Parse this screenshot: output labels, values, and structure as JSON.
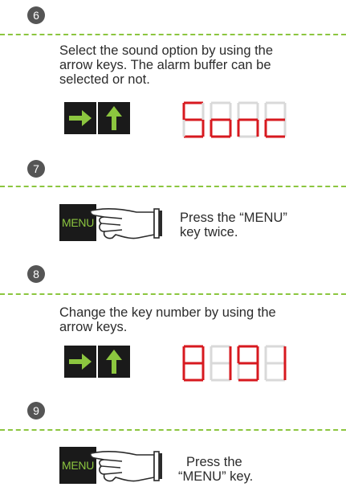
{
  "colors": {
    "accent_green": "#8cc63f",
    "segment_red": "#d7191f",
    "segment_dim": "#d9d9d9",
    "badge": "#555555",
    "key_bg": "#1a1a1a"
  },
  "steps": [
    {
      "number": "6",
      "text": [
        "Select the sound option by using the",
        "arrow keys. The alarm buffer can be",
        "selected or not."
      ],
      "icons": [
        "arrow-right-icon",
        "arrow-up-icon"
      ],
      "display": "Sonc"
    },
    {
      "number": "7",
      "key_label": "MENU",
      "text": [
        "Press the “MENU”",
        "key twice."
      ],
      "icon": "pointing-hand-icon"
    },
    {
      "number": "8",
      "text": [
        "Change the key number by using the",
        "arrow keys."
      ],
      "icons": [
        "arrow-right-icon",
        "arrow-up-icon"
      ],
      "display": "8191"
    },
    {
      "number": "9",
      "key_label": "MENU",
      "text": [
        "Press the",
        "“MENU” key."
      ],
      "icon": "pointing-hand-icon"
    }
  ]
}
